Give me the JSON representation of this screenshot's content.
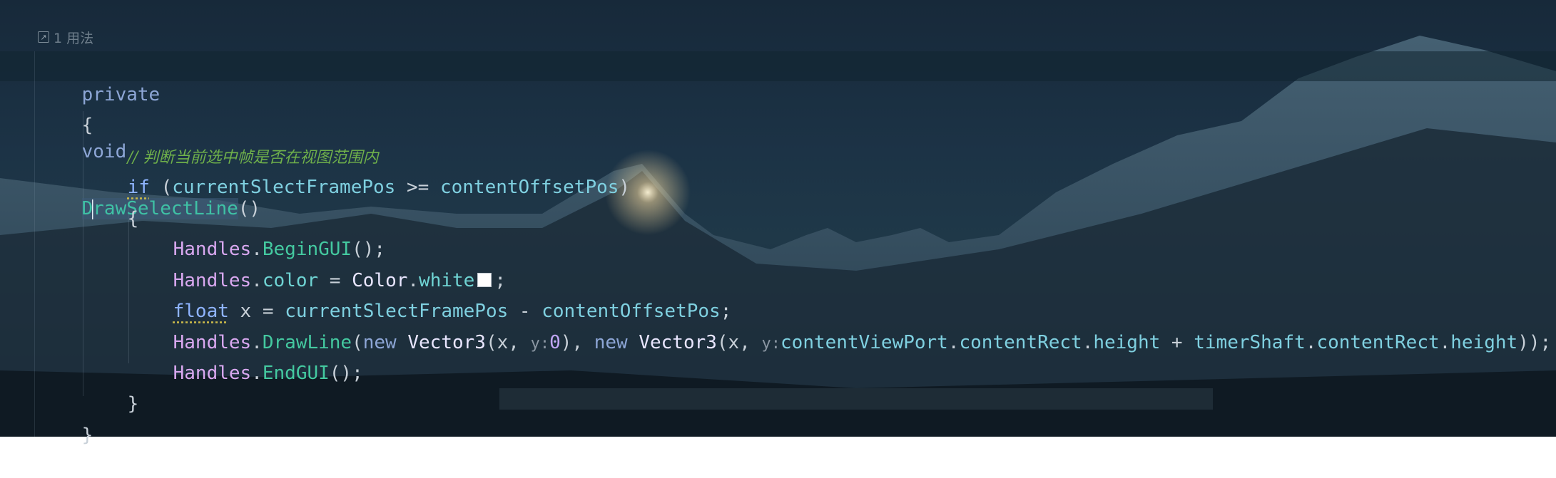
{
  "usage_hint": {
    "icon": "external-link-icon",
    "text": "1 用法"
  },
  "code": {
    "l1": {
      "kw_private": "private",
      "kw_void": "void",
      "fn_head": "D",
      "fn_tail": "rawSelectLine",
      "parens": "()"
    },
    "l2": {
      "brace": "{"
    },
    "l3": {
      "comment": "// 判断当前选中帧是否在视图范围内"
    },
    "l4": {
      "kw_if": "if",
      "open": " (",
      "var1": "currentSlectFramePos",
      "op": " >= ",
      "var2": "contentOffsetPos",
      "close": ")"
    },
    "l5": {
      "brace": "{"
    },
    "l6": {
      "cls": "Handles",
      "dot": ".",
      "fn": "BeginGUI",
      "rest": "();"
    },
    "l7": {
      "cls": "Handles",
      "dot": ".",
      "prop": "color",
      "op": " = ",
      "cls2": "Color",
      "dot2": ".",
      "prop2": "white",
      "swatch_color": "#ffffff",
      "rest": ";"
    },
    "l8": {
      "kw": "float",
      "decl": " x = ",
      "var1": "currentSlectFramePos",
      "op": " - ",
      "var2": "contentOffsetPos",
      "rest": ";"
    },
    "l9": {
      "cls": "Handles",
      "dot": ".",
      "fn": "DrawLine",
      "p1": "(",
      "kw_new1": "new",
      "type1": " Vector3",
      "p2": "(x, ",
      "hint1": "y:",
      "num": "0",
      "p3": "), ",
      "kw_new2": "new",
      "type2": " Vector3",
      "p4": "(x, ",
      "hint2": "y:",
      "f1": "contentViewPort",
      "d1": ".",
      "f2": "contentRect",
      "d2": ".",
      "f3": "height",
      "plus": " + ",
      "f4": "timerShaft",
      "d3": ".",
      "f5": "contentRect",
      "d4": ".",
      "f6": "height",
      "end": "));"
    },
    "l10": {
      "cls": "Handles",
      "dot": ".",
      "fn": "EndGUI",
      "rest": "();"
    },
    "l11": {
      "brace": "}"
    },
    "l12": {
      "brace": "}"
    }
  },
  "colors": {
    "keyword": "#8da6d6",
    "function": "#44c9a0",
    "class": "#d9a8f0",
    "field": "#7fd0e0",
    "comment": "#6fb04a"
  }
}
